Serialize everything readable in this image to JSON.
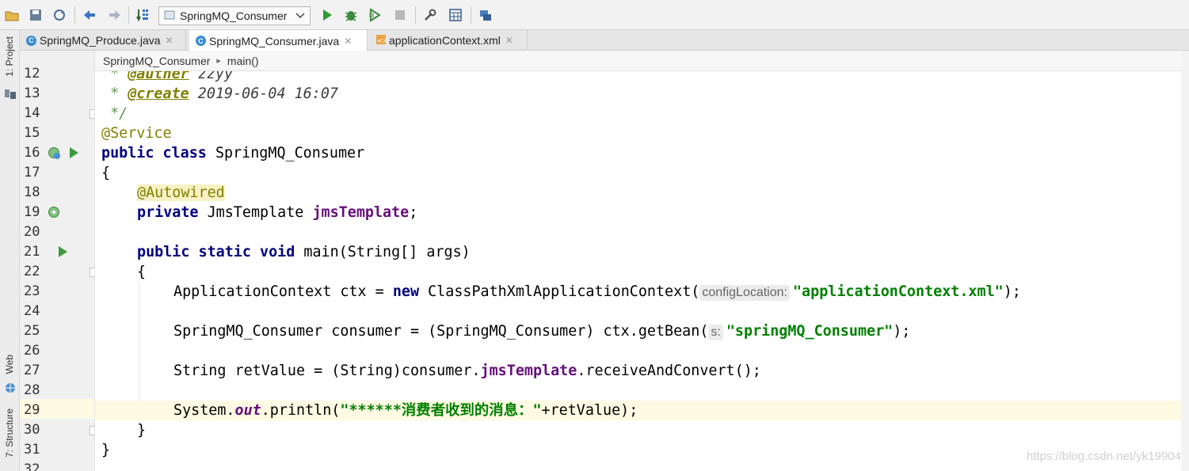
{
  "toolbar": {
    "run_config": "SpringMQ_Consumer",
    "icons": [
      "open-icon",
      "save-icon",
      "sync-icon",
      "back-icon",
      "forward-icon",
      "build-icon",
      "run-icon",
      "debug-icon",
      "coverage-icon",
      "stop-icon",
      "settings-icon",
      "structure-icon",
      "vcs-icon"
    ]
  },
  "left_strip": {
    "project_label": "1: Project",
    "web_label": "Web",
    "structure_label": "7: Structure"
  },
  "tabs": [
    {
      "label": "SpringMQ_Produce.java",
      "icon": "java-class-icon",
      "active": false
    },
    {
      "label": "SpringMQ_Consumer.java",
      "icon": "java-class-icon",
      "active": true
    },
    {
      "label": "applicationContext.xml",
      "icon": "xml-file-icon",
      "active": false
    }
  ],
  "breadcrumb": {
    "class": "SpringMQ_Consumer",
    "method": "main()"
  },
  "line_numbers": [
    "12",
    "13",
    "14",
    "15",
    "16",
    "17",
    "18",
    "19",
    "20",
    "21",
    "22",
    "23",
    "24",
    "25",
    "26",
    "27",
    "28",
    "29",
    "30",
    "31",
    "32"
  ],
  "code": {
    "l12_prefix": " * ",
    "l12_tag": "@auther",
    "l12_val": " zzyy",
    "l13_prefix": " * ",
    "l13_tag": "@create",
    "l13_val": " 2019-06-04 16:07",
    "l14": " */",
    "l15": "@Service",
    "l16_kw": "public class",
    "l16_rest": " SpringMQ_Consumer",
    "l17": "{",
    "l18": "@Autowired",
    "l19_kw": "private",
    "l19_type": " JmsTemplate ",
    "l19_field": "jmsTemplate",
    "l19_end": ";",
    "l21_kw": "public static void",
    "l21_rest": " main(String[] args)",
    "l22": "{",
    "l23_a": "ApplicationContext ctx = ",
    "l23_kw": "new",
    "l23_b": " ClassPathXmlApplicationContext(",
    "l23_hint": "configLocation:",
    "l23_str": "\"applicationContext.xml\"",
    "l23_end": ");",
    "l25_a": "SpringMQ_Consumer consumer = (SpringMQ_Consumer) ctx.getBean(",
    "l25_hint": "s:",
    "l25_str": "\"springMQ_Consumer\"",
    "l25_end": ");",
    "l27_a": "String retValue = (String)consumer.",
    "l27_field": "jmsTemplate",
    "l27_b": ".receiveAndConvert();",
    "l29_a": "System.",
    "l29_out": "out",
    "l29_b": ".println(",
    "l29_str_a": "\"******",
    "l29_str_cjk": "消费者收到的消息：",
    "l29_str_b": "\"",
    "l29_c": "+retValue);",
    "l30": "}",
    "l31": "}"
  },
  "watermark": "https://blog.csdn.net/yk19904",
  "colors": {
    "keyword": "#000080",
    "annotation": "#808000",
    "string": "#008000",
    "field": "#660e7a",
    "current_line": "#fffae3",
    "run_green": "#3d9b3d"
  }
}
